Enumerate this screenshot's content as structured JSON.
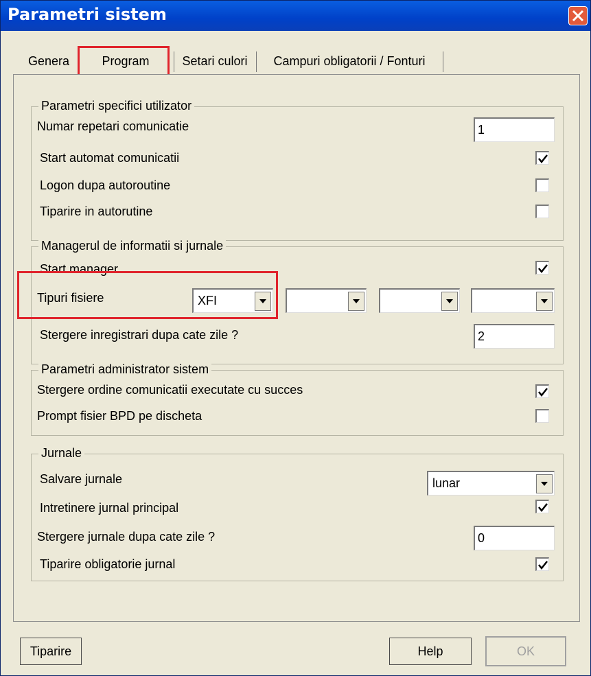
{
  "window": {
    "title": "Parametri sistem"
  },
  "tabs": [
    {
      "label": "Genera"
    },
    {
      "label": "Program"
    },
    {
      "label": "Setari culori"
    },
    {
      "label": "Campuri obligatorii / Fonturi"
    }
  ],
  "groups": {
    "user": {
      "legend": "Parametri specifici utilizator",
      "numar_repetari": {
        "label": "Numar repetari comunicatie",
        "value": "1"
      },
      "start_automat": {
        "label": "Start automat comunicatii",
        "checked": true
      },
      "logon": {
        "label": "Logon dupa autoroutine",
        "checked": false
      },
      "tiparire": {
        "label": "Tiparire in autorutine",
        "checked": false
      }
    },
    "manager": {
      "legend": "Managerul de informatii si jurnale",
      "start_manager": {
        "label": "Start manager",
        "checked": true
      },
      "tipuri_fisiere": {
        "label": "Tipuri fisiere",
        "selects": [
          "XFI",
          "",
          "",
          ""
        ]
      },
      "stergere_inregistrari": {
        "label": "Stergere inregistrari dupa cate zile ?",
        "value": "2"
      }
    },
    "admin": {
      "legend": "Parametri administrator sistem",
      "stergere_ordine": {
        "label": "Stergere ordine comunicatii executate cu succes",
        "checked": true
      },
      "prompt_bpd": {
        "label": "Prompt fisier BPD pe discheta",
        "checked": false
      }
    },
    "jurnale": {
      "legend": "Jurnale",
      "salvare": {
        "label": "Salvare jurnale",
        "value": "lunar"
      },
      "intretinere": {
        "label": "Intretinere jurnal principal",
        "checked": true
      },
      "stergere_jurnale": {
        "label": "Stergere jurnale dupa cate zile ?",
        "value": "0"
      },
      "tiparire_obligatorie": {
        "label": "Tiparire obligatorie jurnal",
        "checked": true
      }
    }
  },
  "buttons": {
    "print": "Tiparire",
    "help": "Help",
    "ok": "OK"
  },
  "colors": {
    "titlebar": "#0a54d6",
    "highlight": "#e0242c",
    "dialog_bg": "#ece9d8"
  },
  "icons": {
    "close": "close-icon",
    "check": "check-icon",
    "dropdown": "chevron-down-icon"
  }
}
